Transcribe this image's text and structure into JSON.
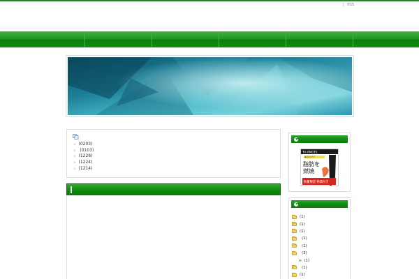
{
  "header": {
    "separator": "|",
    "rss_label": "RSS"
  },
  "nav": {
    "items": [
      "",
      "",
      "",
      "",
      ""
    ]
  },
  "news": {
    "icon": "pages-icon",
    "items": [
      {
        "date": "(0203)"
      },
      {
        "date": " (0103)"
      },
      {
        "date": "(1228)"
      },
      {
        "date": "(1224)"
      },
      {
        "date": "(1214)"
      }
    ]
  },
  "sidebar": {
    "ad": {
      "brand": "Tri-ANGEL",
      "line1": "着るだけで",
      "line2": "脂肪を",
      "line3": "燃焼",
      "badge": "数量限定 特典付き"
    },
    "categories": [
      {
        "count": "(1)",
        "sub": false,
        "arrow": false
      },
      {
        "count": "(1)",
        "sub": false,
        "arrow": false
      },
      {
        "count": "(1)",
        "sub": false,
        "arrow": false
      },
      {
        "count": "(1)",
        "sub": false,
        "arrow": false,
        "indent": true
      },
      {
        "count": "(1)",
        "sub": false,
        "arrow": false,
        "indent": true
      },
      {
        "count": "(3)",
        "sub": false,
        "arrow": false,
        "indent": true
      },
      {
        "count": "(1)",
        "sub": true,
        "arrow": true
      },
      {
        "count": "(1)",
        "sub": false,
        "arrow": false,
        "indent": true
      },
      {
        "count": "(1)",
        "sub": false,
        "arrow": false
      }
    ]
  },
  "colors": {
    "accent_green": "#1f9a1f",
    "banner_teal": "#2aa3b8"
  }
}
